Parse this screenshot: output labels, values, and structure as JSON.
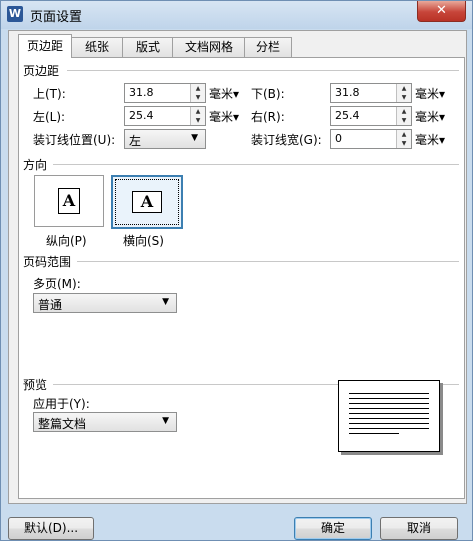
{
  "window": {
    "title": "页面设置",
    "app_icon": "W",
    "close_glyph": "✕"
  },
  "tabs": [
    {
      "label": "页边距",
      "active": true
    },
    {
      "label": "纸张"
    },
    {
      "label": "版式"
    },
    {
      "label": "文档网格"
    },
    {
      "label": "分栏"
    }
  ],
  "margins": {
    "section": "页边距",
    "top_label": "上(T):",
    "top_value": "31.8",
    "bottom_label": "下(B):",
    "bottom_value": "31.8",
    "left_label": "左(L):",
    "left_value": "25.4",
    "right_label": "右(R):",
    "right_value": "25.4",
    "gutter_pos_label": "装订线位置(U):",
    "gutter_pos_value": "左",
    "gutter_width_label": "装订线宽(G):",
    "gutter_width_value": "0",
    "unit": "毫米"
  },
  "orientation": {
    "section": "方向",
    "portrait_label": "纵向(P)",
    "landscape_label": "横向(S)",
    "glyph": "A",
    "selected": "landscape"
  },
  "page_range": {
    "section": "页码范围",
    "multi_label": "多页(M):",
    "multi_value": "普通"
  },
  "preview": {
    "section": "预览",
    "apply_label": "应用于(Y):",
    "apply_value": "整篇文档"
  },
  "buttons": {
    "default": "默认(D)...",
    "ok": "确定",
    "cancel": "取消"
  }
}
